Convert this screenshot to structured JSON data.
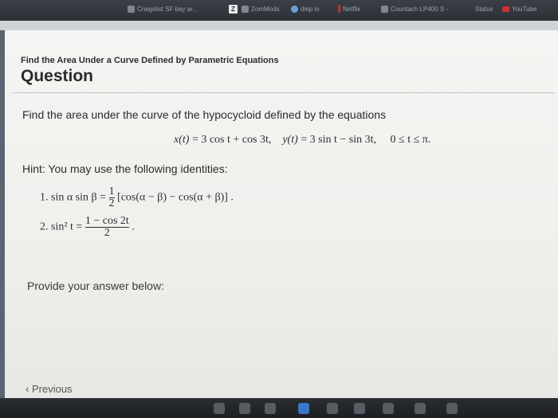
{
  "bookmarks": [
    {
      "label": "Craigslist SF bay ar...",
      "icon": "craigslist-icon"
    },
    {
      "label": "Z",
      "icon": "zomato-icon"
    },
    {
      "label": "ZomMods",
      "icon": "folder-icon"
    },
    {
      "label": "diep.io",
      "icon": "diep-icon"
    },
    {
      "label": "Netflix",
      "icon": "netflix-icon"
    },
    {
      "label": "Countach LP400 S -",
      "icon": "page-icon"
    },
    {
      "label": "Status",
      "icon": "page-icon"
    },
    {
      "label": "YouTube",
      "icon": "youtube-icon"
    }
  ],
  "question": {
    "subheading": "Find the Area Under a Curve Defined by Parametric Equations",
    "heading": "Question",
    "prompt": "Find the area under the curve of the hypocycloid defined by the equations",
    "equation": {
      "x_lhs": "x(t)",
      "x_rhs": "= 3 cos t + cos 3t,",
      "y_lhs": "y(t)",
      "y_rhs": "= 3 sin t − sin 3t,",
      "range": "0 ≤ t ≤ π."
    },
    "hint_label": "Hint: You may use the following identities:",
    "identities": {
      "id1_prefix": "1. sin α sin β =",
      "id1_frac_num": "1",
      "id1_frac_den": "2",
      "id1_rest": "[cos(α − β) − cos(α + β)] .",
      "id2_prefix": "2. sin² t =",
      "id2_frac_num": "1 − cos 2t",
      "id2_frac_den": "2",
      "id2_rest": "."
    },
    "answer_label": "Provide your answer below:"
  },
  "navigation": {
    "previous_label": "Previous",
    "previous_chevron": "‹"
  }
}
